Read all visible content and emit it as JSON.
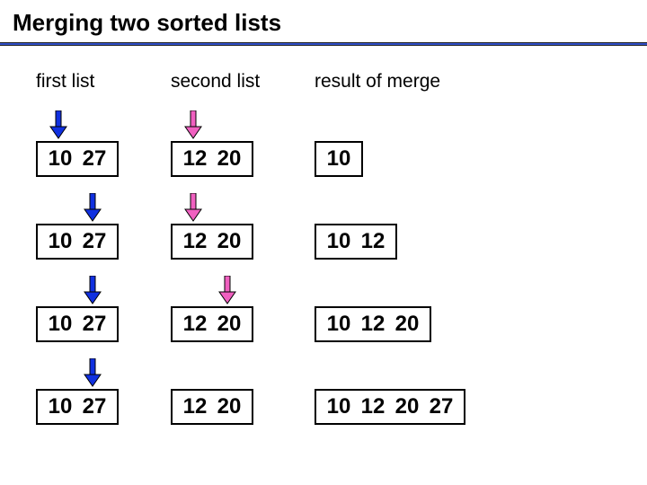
{
  "title": "Merging two sorted lists",
  "headers": {
    "first": "first list",
    "second": "second list",
    "result": "result of merge"
  },
  "colors": {
    "blue_arrow": "#1030e0",
    "pink_arrow": "#f060c0",
    "underline": "#3050c8"
  },
  "rows": [
    {
      "first": [
        "10",
        "27"
      ],
      "second": [
        "12",
        "20"
      ],
      "result": [
        "10"
      ],
      "first_arrow_index": 0,
      "second_arrow_index": 0
    },
    {
      "first": [
        "10",
        "27"
      ],
      "second": [
        "12",
        "20"
      ],
      "result": [
        "10",
        "12"
      ],
      "first_arrow_index": 1,
      "second_arrow_index": 0
    },
    {
      "first": [
        "10",
        "27"
      ],
      "second": [
        "12",
        "20"
      ],
      "result": [
        "10",
        "12",
        "20"
      ],
      "first_arrow_index": 1,
      "second_arrow_index": 1
    },
    {
      "first": [
        "10",
        "27"
      ],
      "second": [
        "12",
        "20"
      ],
      "result": [
        "10",
        "12",
        "20",
        "27"
      ],
      "first_arrow_index": 1,
      "second_arrow_index": null
    }
  ]
}
